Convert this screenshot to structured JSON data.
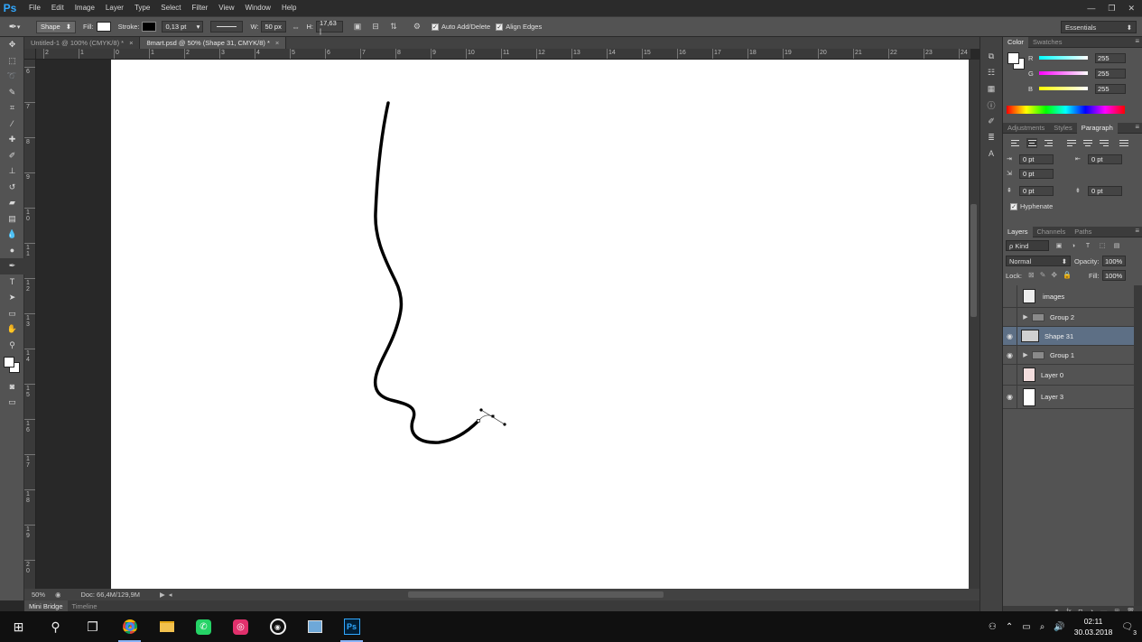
{
  "app": {
    "logo": "Ps",
    "menu": [
      "File",
      "Edit",
      "Image",
      "Layer",
      "Type",
      "Select",
      "Filter",
      "View",
      "Window",
      "Help"
    ],
    "window_controls": [
      "—",
      "❐",
      "✕"
    ]
  },
  "options_bar": {
    "mode": "Shape",
    "fill_label": "Fill:",
    "stroke_label": "Stroke:",
    "stroke_width": "0,13 pt",
    "w_label": "W:",
    "w_value": "50 px",
    "h_label": "H:",
    "h_value": "17,63 |",
    "auto_add_delete": "Auto Add/Delete",
    "align_edges": "Align Edges",
    "workspace": "Essentials"
  },
  "document_tabs": [
    {
      "label": "Untitled-1 @ 100% (CMYK/8) *",
      "active": false
    },
    {
      "label": "8mart.psd @ 50% (Shape 31, CMYK/8) *",
      "active": true
    }
  ],
  "rulers": {
    "horizontal": [
      "2",
      "1",
      "0",
      "1",
      "2",
      "3",
      "4",
      "5",
      "6",
      "7",
      "8",
      "9",
      "10",
      "11",
      "12",
      "13",
      "14",
      "15",
      "16",
      "17",
      "18",
      "19",
      "20",
      "21",
      "22",
      "23",
      "24"
    ],
    "vertical": [
      "6",
      "7",
      "8",
      "9",
      "1 0",
      "1 1",
      "1 2",
      "1 3",
      "1 4",
      "1 5",
      "1 6",
      "1 7",
      "1 8",
      "1 9",
      "2 0"
    ]
  },
  "status": {
    "zoom": "50%",
    "doc": "Doc: 66,4M/129,9M"
  },
  "bottom_tabs": [
    "Mini Bridge",
    "Timeline"
  ],
  "color_panel": {
    "tabs": [
      "Color",
      "Swatches"
    ],
    "r_label": "R",
    "r_value": "255",
    "g_label": "G",
    "g_value": "255",
    "b_label": "B",
    "b_value": "255"
  },
  "paragraph_panel": {
    "tabs": [
      "Adjustments",
      "Styles",
      "Paragraph"
    ],
    "indent_left": "0 pt",
    "indent_right": "0 pt",
    "indent_first": "0 pt",
    "space_before": "0 pt",
    "space_after": "0 pt",
    "hyphenate": "Hyphenate"
  },
  "layers_panel": {
    "tabs": [
      "Layers",
      "Channels",
      "Paths"
    ],
    "kind": "ρ Kind",
    "blend_mode": "Normal",
    "opacity_label": "Opacity:",
    "opacity": "100%",
    "lock_label": "Lock:",
    "fill_label": "Fill:",
    "fill": "100%",
    "layers": [
      {
        "name": "images",
        "visible": false,
        "type": "smart"
      },
      {
        "name": "Group 2",
        "visible": false,
        "type": "group"
      },
      {
        "name": "Shape 31",
        "visible": true,
        "type": "shape",
        "selected": true
      },
      {
        "name": "Group 1",
        "visible": true,
        "type": "group"
      },
      {
        "name": "Layer 0",
        "visible": false,
        "type": "pixel"
      },
      {
        "name": "Layer 3",
        "visible": true,
        "type": "pixel"
      }
    ]
  },
  "taskbar": {
    "time": "02:11",
    "date": "30.03.2018",
    "notifications": "3"
  }
}
